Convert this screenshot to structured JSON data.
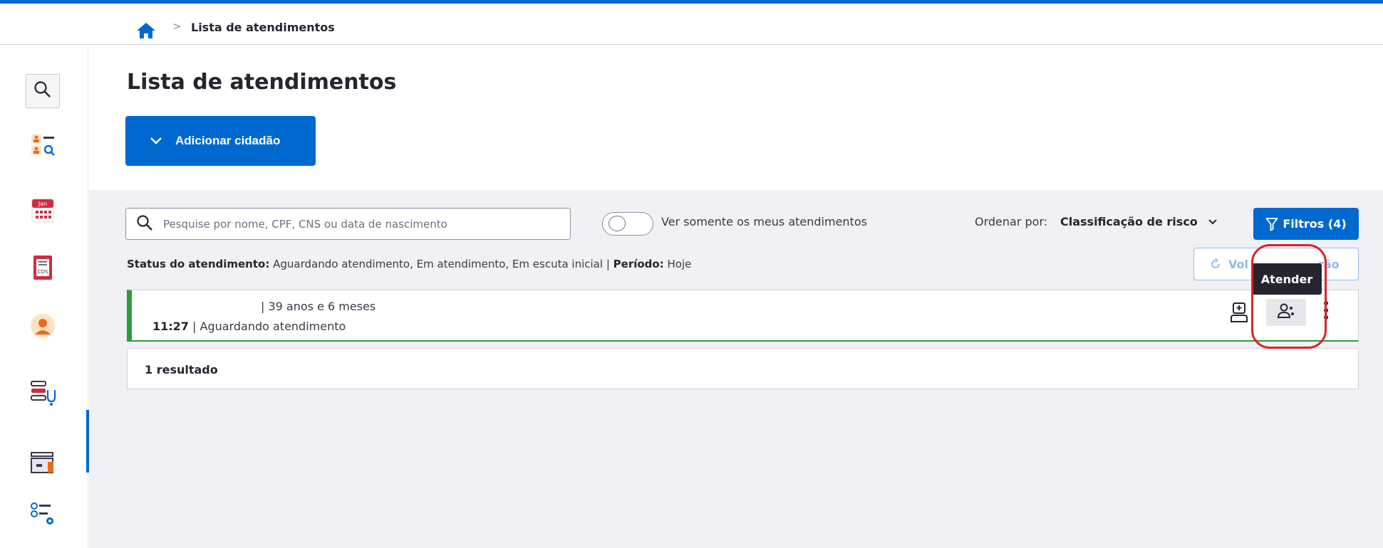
{
  "breadcrumb": {
    "current": "Lista de atendimentos",
    "separator": ">"
  },
  "sidebar": {
    "items": [
      {
        "icon": "search-icon"
      },
      {
        "icon": "citizen-search-icon"
      },
      {
        "icon": "calendar-icon",
        "badge": "Jan"
      },
      {
        "icon": "cds-document-icon",
        "badge": "CDS"
      },
      {
        "icon": "avatar-icon"
      },
      {
        "icon": "attendance-list-icon",
        "active": true
      },
      {
        "icon": "drawer-icon"
      },
      {
        "icon": "settings-list-icon"
      }
    ]
  },
  "page": {
    "title": "Lista de atendimentos",
    "add_button": "Adicionar cidadão"
  },
  "filters": {
    "search_placeholder": "Pesquise por nome, CPF, CNS ou data de nascimento",
    "toggle_label": "Ver somente os meus atendimentos",
    "toggle_on": false,
    "sort_label": "Ordenar por:",
    "sort_value": "Classificação de risco",
    "filters_button": "Filtros (4)",
    "status_label": "Status do atendimento:",
    "status_value": "Aguardando atendimento, Em atendimento, Em escuta inicial",
    "status_separator": "|",
    "period_label": "Período:",
    "period_value": "Hoje",
    "restore_button_visible_start": "Vol",
    "restore_button_visible_end": "rão"
  },
  "tooltip": "Atender",
  "attendance": [
    {
      "age": "| 39 anos e 6 meses",
      "time": "11:27",
      "status": "| Aguardando atendimento",
      "risk_color": "#2e9b3e"
    }
  ],
  "results_count": "1 resultado",
  "colors": {
    "primary": "#0069d0",
    "risk_green": "#2e9b3e",
    "highlight": "#e0202a"
  }
}
